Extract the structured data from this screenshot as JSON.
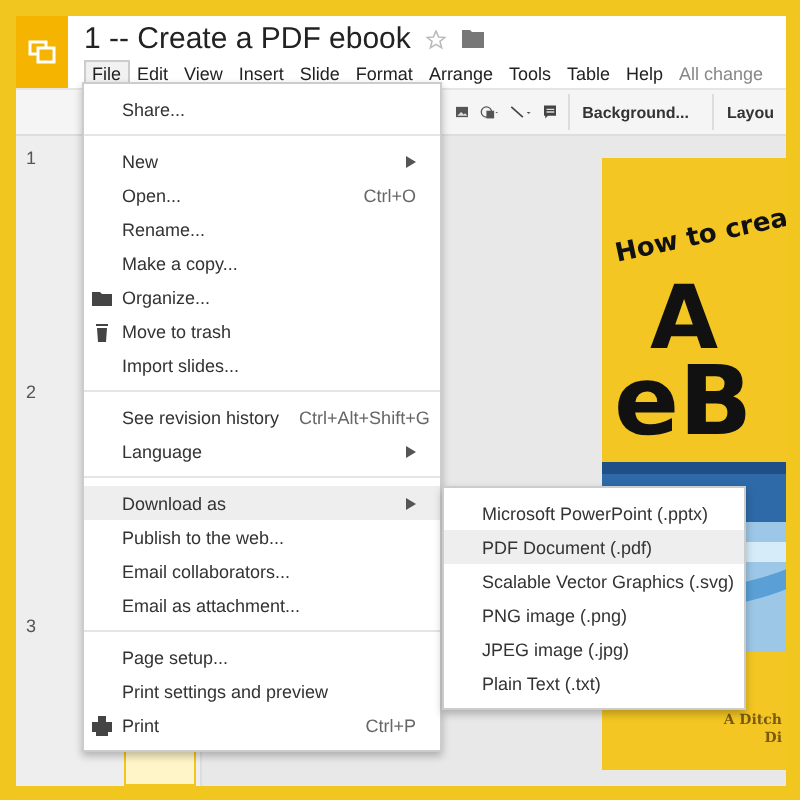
{
  "window": {
    "title": "1 -- Create a PDF ebook"
  },
  "menu_bar": [
    {
      "label": "File",
      "selected": true
    },
    {
      "label": "Edit",
      "selected": false
    },
    {
      "label": "View",
      "selected": false
    },
    {
      "label": "Insert",
      "selected": false
    },
    {
      "label": "Slide",
      "selected": false
    },
    {
      "label": "Format",
      "selected": false
    },
    {
      "label": "Arrange",
      "selected": false
    },
    {
      "label": "Tools",
      "selected": false
    },
    {
      "label": "Table",
      "selected": false
    },
    {
      "label": "Help",
      "selected": false
    }
  ],
  "save_status": "All change",
  "toolbar": {
    "buttons": [
      "Background...",
      "Layou"
    ]
  },
  "filmstrip": [
    "1",
    "2",
    "3"
  ],
  "file_menu": [
    [
      {
        "label": "Share...",
        "highlighted": false
      }
    ],
    [
      {
        "label": "New",
        "submenu": true,
        "highlighted": false
      },
      {
        "label": "Open...",
        "shortcut": "Ctrl+O",
        "highlighted": false
      },
      {
        "label": "Rename...",
        "highlighted": false
      },
      {
        "label": "Make a copy...",
        "highlighted": false
      },
      {
        "label": "Organize...",
        "highlighted": false
      },
      {
        "label": "Move to trash",
        "highlighted": false
      },
      {
        "label": "Import slides...",
        "highlighted": false
      }
    ],
    [
      {
        "label": "See revision history",
        "shortcut": "Ctrl+Alt+Shift+G",
        "highlighted": false
      },
      {
        "label": "Language",
        "submenu": true,
        "highlighted": false
      }
    ],
    [
      {
        "label": "Download as",
        "submenu": true,
        "highlighted": true
      },
      {
        "label": "Publish to the web...",
        "highlighted": false
      },
      {
        "label": "Email collaborators...",
        "highlighted": false
      },
      {
        "label": "Email as attachment...",
        "highlighted": false
      }
    ],
    [
      {
        "label": "Page setup...",
        "highlighted": false
      },
      {
        "label": "Print settings and preview",
        "highlighted": false
      },
      {
        "label": "Print",
        "shortcut": "Ctrl+P",
        "highlighted": false
      }
    ]
  ],
  "download_submenu": [
    {
      "label": "Microsoft PowerPoint (.pptx)",
      "highlighted": false
    },
    {
      "label": "PDF Document (.pdf)",
      "highlighted": true
    },
    {
      "label": "Scalable Vector Graphics (.svg)",
      "highlighted": false
    },
    {
      "label": "PNG image (.png)",
      "highlighted": false
    },
    {
      "label": "JPEG image (.jpg)",
      "highlighted": false
    },
    {
      "label": "Plain Text (.txt)",
      "highlighted": false
    }
  ],
  "slide": {
    "headline": "How to crea",
    "big_lines": [
      "A",
      "eB"
    ],
    "footer_lines": [
      "A Ditch",
      "Di"
    ]
  }
}
